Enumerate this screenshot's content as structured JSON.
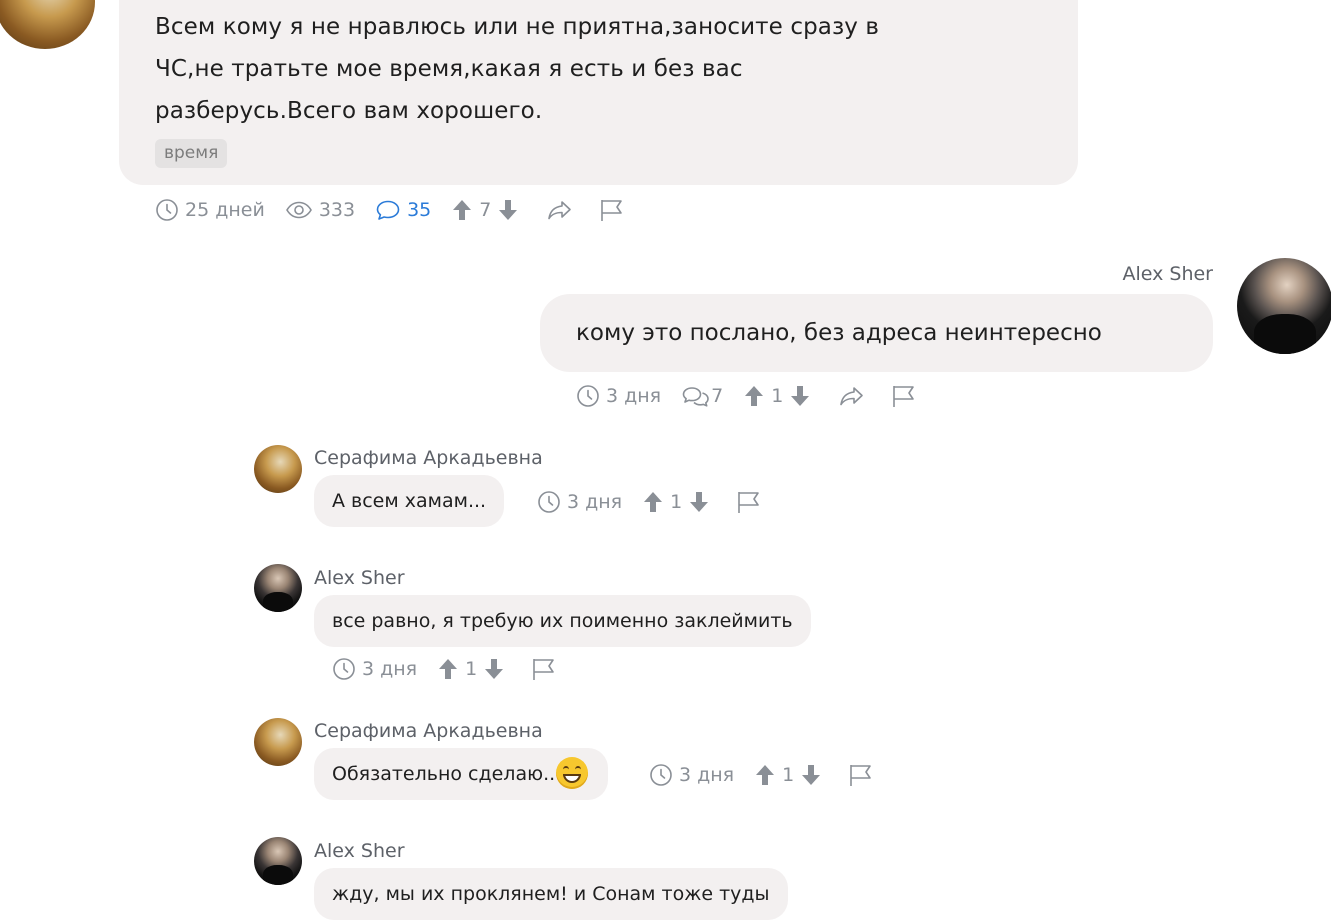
{
  "post": {
    "text_lines": [
      "Всем кому я не нравлюсь или не приятна,заносите сразу в",
      "ЧС,не тратьте мое время,какая я есть и без вас",
      "разберусь.Всего вам хорошего."
    ],
    "tag": "время",
    "meta": {
      "time": "25 дней",
      "views": "333",
      "comments": "35",
      "score": "7"
    }
  },
  "comment": {
    "author": "Alex Sher",
    "text": "кому это послано, без адреса неинтересно",
    "meta": {
      "time": "3 дня",
      "replies": "7",
      "score": "1"
    }
  },
  "replies": [
    {
      "author": "Серафима Аркадьевна",
      "text": "А всем хамам...",
      "time": "3 дня",
      "score": "1"
    },
    {
      "author": "Alex Sher",
      "text": "все равно, я требую их поименно заклеймить",
      "time": "3 дня",
      "score": "1"
    },
    {
      "author": "Серафима Аркадьевна",
      "text": "Обязательно сделаю..",
      "emoji": "grinning-face-emoji",
      "time": "3 дня",
      "score": "1"
    },
    {
      "author": "Alex Sher",
      "text": "жду, мы их проклянем! и Сонам тоже туды"
    }
  ],
  "colors": {
    "bubble": "#f3f0f0",
    "meta_gray": "#8a8f96",
    "link_blue": "#2b7bd8",
    "tag_bg": "#e4e2e2"
  },
  "icons": [
    "clock-icon",
    "eye-icon",
    "comment-icon",
    "replies-icon",
    "upvote-icon",
    "downvote-icon",
    "share-icon",
    "flag-icon"
  ]
}
